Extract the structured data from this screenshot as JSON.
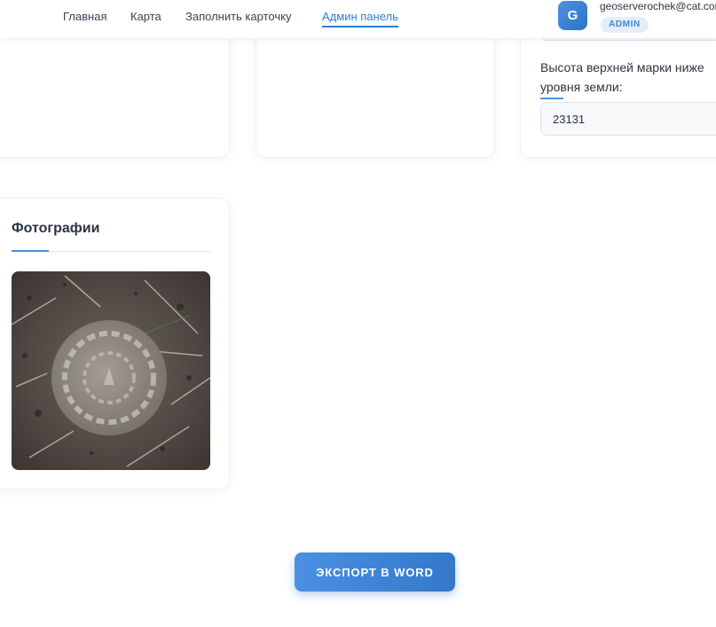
{
  "nav": {
    "items": [
      {
        "label": "Главная",
        "active": false
      },
      {
        "label": "Карта",
        "active": false
      },
      {
        "label": "Заполнить карточку",
        "active": false
      },
      {
        "label": "Админ панель",
        "active": true
      }
    ]
  },
  "user": {
    "avatar_letter": "G",
    "email": "geoserverochek@cat.com",
    "role": "ADMIN"
  },
  "form": {
    "height_field": {
      "label_line1": "Высота верхней марки ниже",
      "label_line2": "уровня земли:",
      "value": "23131"
    }
  },
  "photos": {
    "title": "Фотографии",
    "items": [
      {
        "description": "photo of survey marker in soil"
      }
    ]
  },
  "actions": {
    "export_label": "ЭКСПОРТ В WORD"
  },
  "colors": {
    "accent": "#2d7fd3",
    "button_start": "#4b90e2",
    "button_end": "#3478c9",
    "badge_bg": "#e4eefa"
  }
}
